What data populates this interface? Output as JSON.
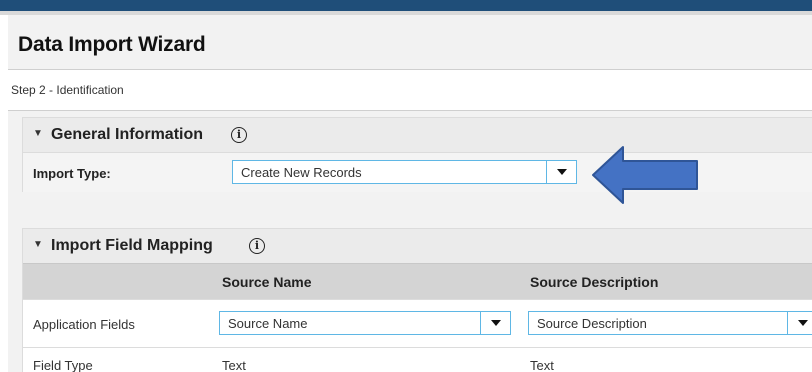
{
  "wizard": {
    "title": "Data Import Wizard",
    "step": "Step 2 - Identification"
  },
  "general_information": {
    "title": "General Information",
    "import_type_label": "Import Type:",
    "import_type_value": "Create New Records"
  },
  "field_mapping": {
    "title": "Import Field Mapping",
    "columns": [
      "Source Name",
      "Source Description"
    ],
    "rows": [
      {
        "label": "Application Fields",
        "values": [
          "Source Name",
          "Source Description"
        ]
      },
      {
        "label": "Field Type",
        "values": [
          "Text",
          "Text"
        ]
      }
    ]
  },
  "icons": {
    "info": "ⓘ",
    "caret": "▼"
  },
  "colors": {
    "top_bar": "#1f4e79",
    "select_border": "#5fb7e5",
    "callout_arrow": "#4472c4"
  }
}
